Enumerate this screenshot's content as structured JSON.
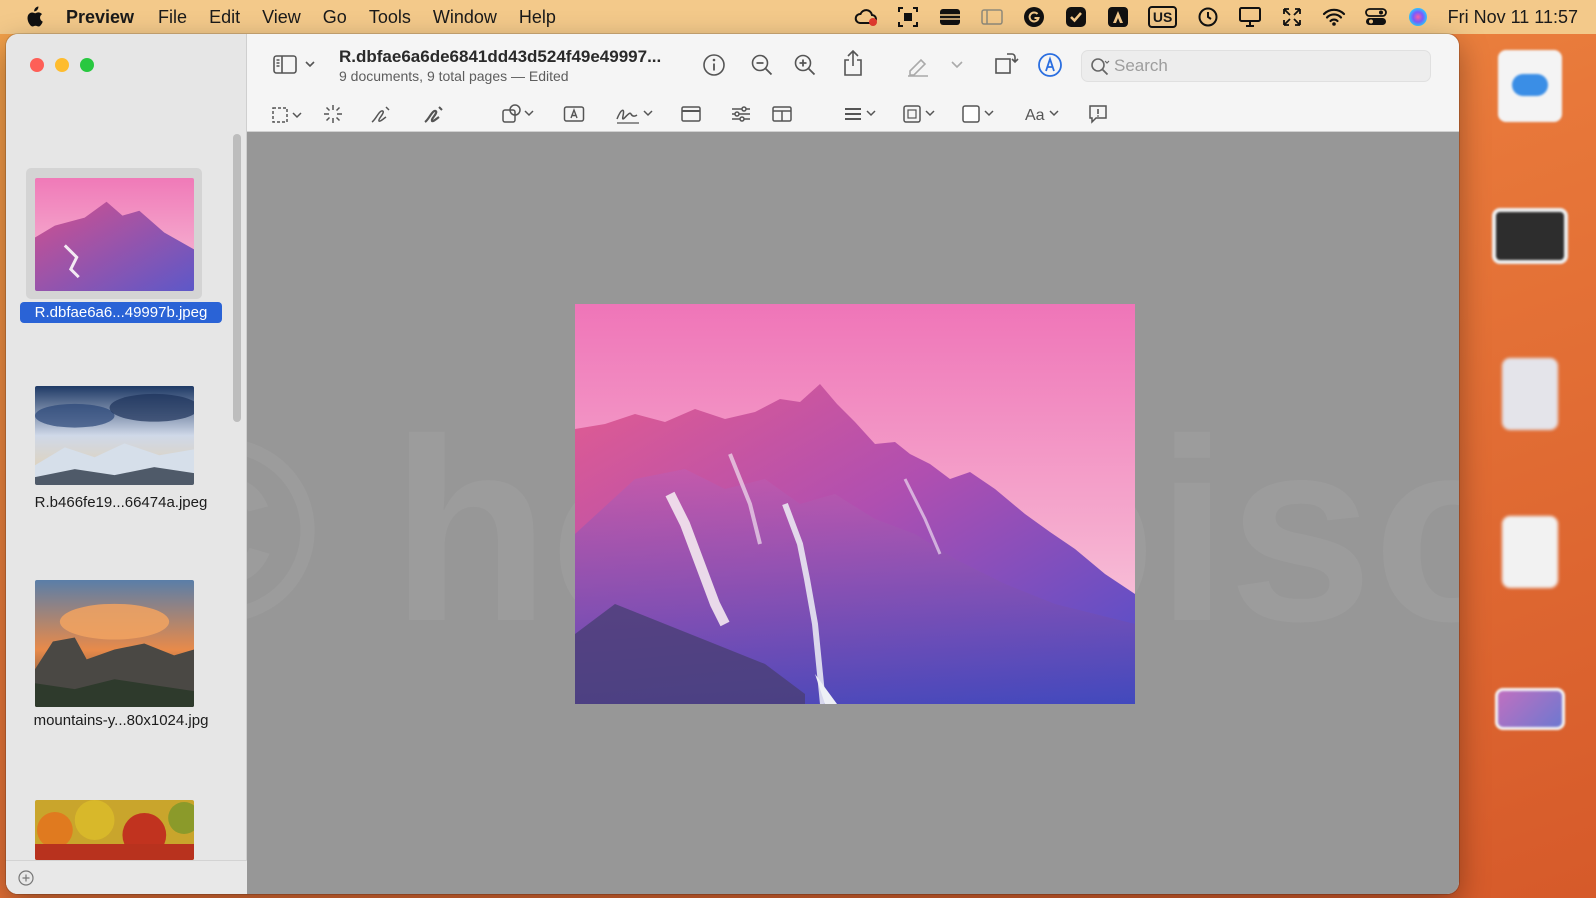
{
  "menubar": {
    "app": "Preview",
    "items": [
      "File",
      "Edit",
      "View",
      "Go",
      "Tools",
      "Window",
      "Help"
    ],
    "status_icons": [
      "creative-cloud-icon",
      "screenshot-icon",
      "wallet-icon",
      "display-mirroring-icon",
      "grammarly-icon",
      "task-check-icon",
      "notes-icon",
      "keyboard-input-icon",
      "time-machine-icon",
      "display-icon",
      "expand-arrows-icon",
      "wifi-icon",
      "control-center-icon",
      "siri-icon"
    ],
    "input_source": "US",
    "clock": "Fri Nov 11  11:57"
  },
  "window": {
    "title": "R.dbfae6a6de6841dd43d524f49e49997...",
    "subtitle": "9 documents, 9 total pages — Edited"
  },
  "search": {
    "placeholder": "Search"
  },
  "sidebar": {
    "thumbnails": [
      {
        "label": "R.dbfae6a6...49997b.jpeg",
        "selected": true
      },
      {
        "label": "R.b466fe19...66474a.jpeg",
        "selected": false
      },
      {
        "label": "mountains-y...80x1024.jpg",
        "selected": false
      },
      {
        "label": "",
        "selected": false
      }
    ]
  },
  "watermark": "© howtoisolve.com",
  "colors": {
    "accent": "#2a63d6",
    "markup_blue": "#2a6ee0",
    "canvas": "#979797"
  },
  "toolbar_icons": [
    "sidebar-toggle-icon",
    "info-icon",
    "zoom-out-icon",
    "zoom-in-icon",
    "share-icon",
    "highlight-pen-icon",
    "rotate-icon",
    "markup-icon",
    "rect-select-icon",
    "instant-alpha-icon",
    "sketch-icon",
    "draw-icon",
    "shapes-icon",
    "text-box-icon",
    "sign-icon",
    "page-icon",
    "adjust-color-icon",
    "adjust-size-icon",
    "line-style-icon",
    "border-color-icon",
    "fill-color-icon",
    "text-style-icon",
    "annotate-icon"
  ]
}
